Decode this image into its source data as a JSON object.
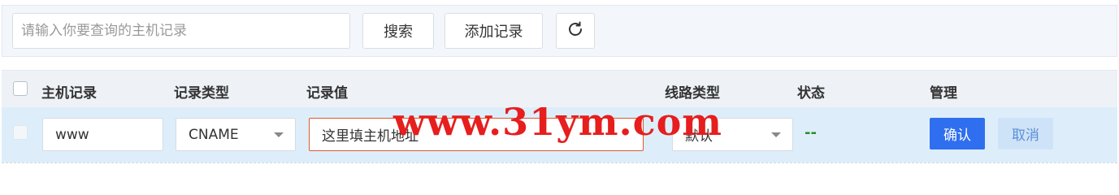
{
  "toolbar": {
    "search_placeholder": "请输入你要查询的主机记录",
    "search_label": "搜索",
    "add_label": "添加记录"
  },
  "table": {
    "headers": [
      "主机记录",
      "记录类型",
      "记录值",
      "线路类型",
      "状态",
      "管理"
    ]
  },
  "row": {
    "host": "www",
    "type": "CNAME",
    "value": "这里填主机地址",
    "line": "默认",
    "status": "--",
    "confirm_label": "确认",
    "cancel_label": "取消"
  },
  "watermark": "www.31ym.com",
  "colors": {
    "primary": "#2f6fef",
    "status": "#2e8b2e",
    "watermark": "#e61e1e",
    "row_highlight": "#ddeefa"
  },
  "icons": {
    "refresh": "refresh-icon",
    "dropdown": "chevron-down-icon"
  }
}
